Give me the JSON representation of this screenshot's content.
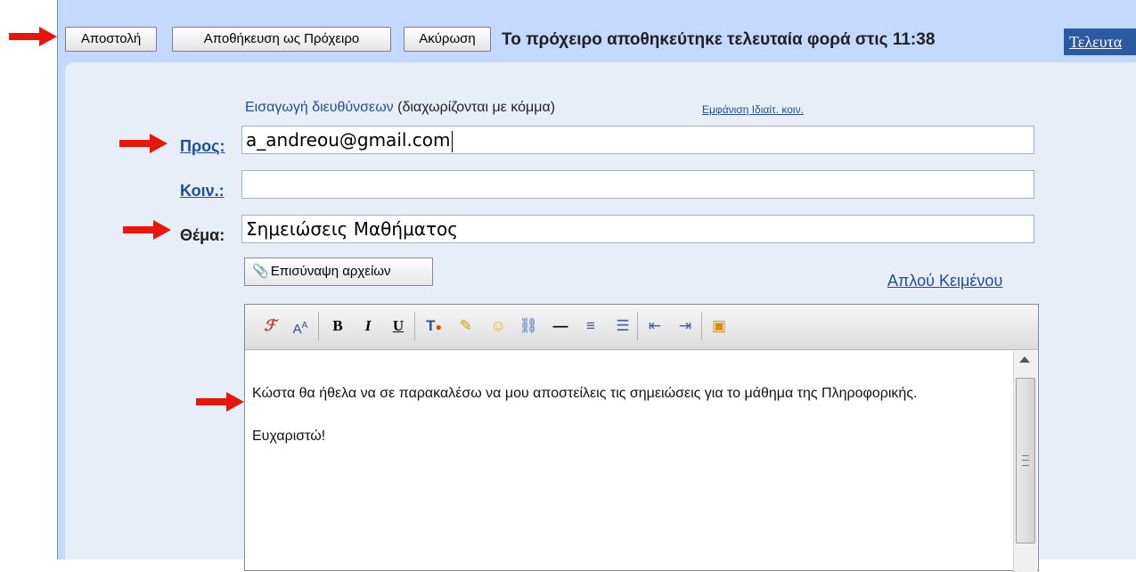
{
  "toolbar": {
    "send_label": "Αποστολή",
    "save_draft_label": "Αποθήκευση ως Πρόχειρο",
    "cancel_label": "Ακύρωση",
    "status_text": "Το πρόχειρο αποθηκεύτηκε τελευταία φορά στις 11:38",
    "last_link_label": "Τελευτα"
  },
  "compose": {
    "hint_link": "Εισαγωγή διευθύνσεων",
    "hint_text": " (διαχωρίζονται με κόμμα)",
    "show_cc_link": "Εμφάνιση Ιδιαίτ. κοιν.",
    "to_label": "Προς:",
    "to_value": "a_andreou@gmail.com",
    "cc_label": "Κοιν.:",
    "cc_value": "",
    "subject_label": "Θέμα:",
    "subject_value": "Σημειώσεις Μαθήματος",
    "attach_label": "Επισύναψη αρχείων",
    "plain_text_link": "Απλού Κειμένου"
  },
  "editor": {
    "line1": "Κώστα θα ήθελα να σε παρακαλέσω να μου αποστείλεις τις σημειώσεις για το μάθημα της Πληροφορικής.",
    "line2": "Ευχαριστώ!",
    "tools": [
      "font-icon",
      "font-size-icon",
      "bold-icon",
      "italic-icon",
      "underline-icon",
      "text-color-icon",
      "highlight-icon",
      "emoticon-icon",
      "link-icon",
      "horizontal-rule-icon",
      "align-icon",
      "bullet-list-icon",
      "outdent-icon",
      "indent-icon",
      "image-icon"
    ]
  },
  "colors": {
    "arrow": "#e8150b",
    "link": "#1f4d9a",
    "toolbar_bg": "#c3d9ff",
    "panel_bg": "#e8eef7"
  }
}
